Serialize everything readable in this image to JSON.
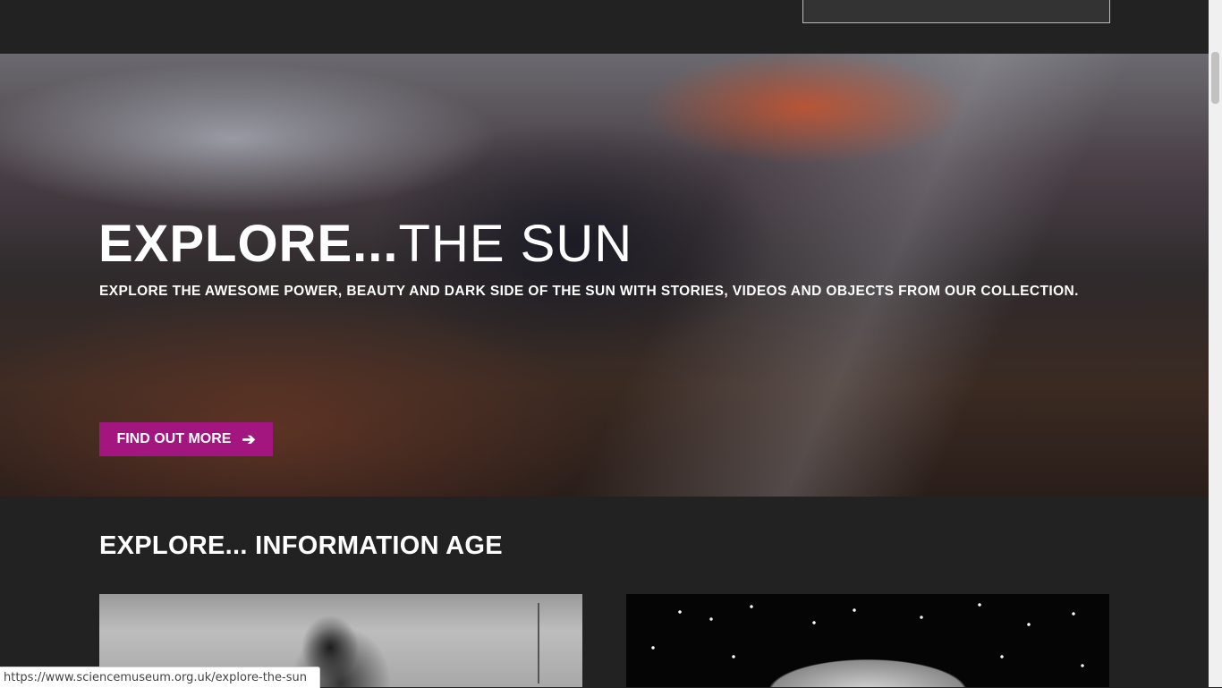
{
  "hero": {
    "title_strong": "EXPLORE...",
    "title_light": "THE SUN",
    "subtitle": "EXPLORE THE AWESOME POWER, BEAUTY AND DARK SIDE OF THE SUN WITH STORIES, VIDEOS AND OBJECTS FROM OUR COLLECTION.",
    "cta_label": "FIND OUT MORE",
    "cta_icon": "arrow-right-icon",
    "cta_color": "#a3157f"
  },
  "section": {
    "title": "EXPLORE... INFORMATION AGE"
  },
  "status_bar": {
    "url": "https://www.sciencemuseum.org.uk/explore-the-sun"
  },
  "colors": {
    "page_background": "#222222",
    "accent": "#a3157f"
  }
}
